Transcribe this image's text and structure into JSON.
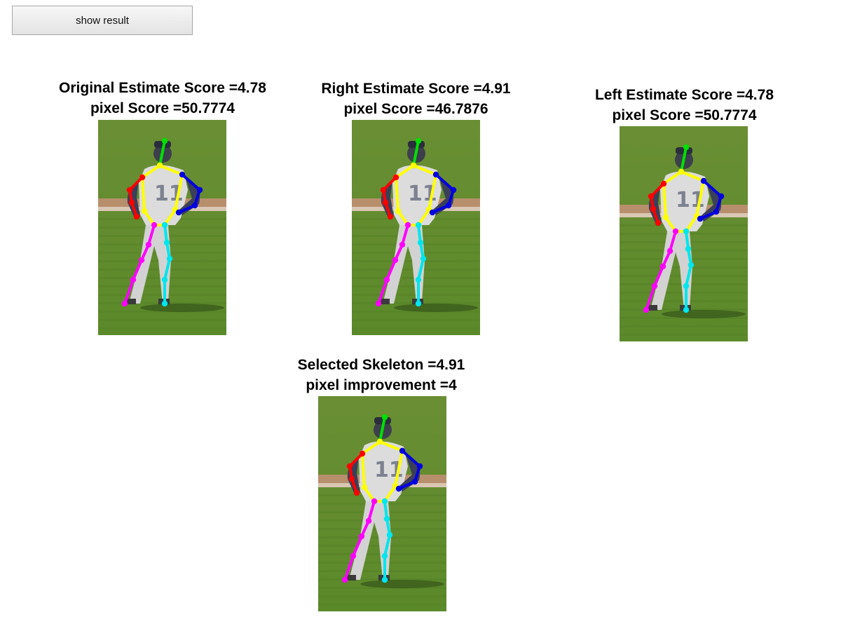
{
  "controls": {
    "show_result_label": "show result"
  },
  "panels": [
    {
      "id": "original",
      "line1": "Original Estimate Score =4.78",
      "line2": "pixel Score =50.7774"
    },
    {
      "id": "right",
      "line1": "Right Estimate Score =4.91",
      "line2": "pixel Score =46.7876"
    },
    {
      "id": "left",
      "line1": "Left Estimate Score =4.78",
      "line2": "pixel Score =50.7774"
    },
    {
      "id": "selected",
      "line1": "Selected Skeleton =4.91",
      "line2": "pixel improvement =4"
    }
  ],
  "limb_colors": {
    "head": "#00e000",
    "torso": "#ffff00",
    "right_arm": "#ff0000",
    "left_arm": "#0000e0",
    "right_leg": "#ff00ff",
    "left_leg": "#00e5ee"
  }
}
